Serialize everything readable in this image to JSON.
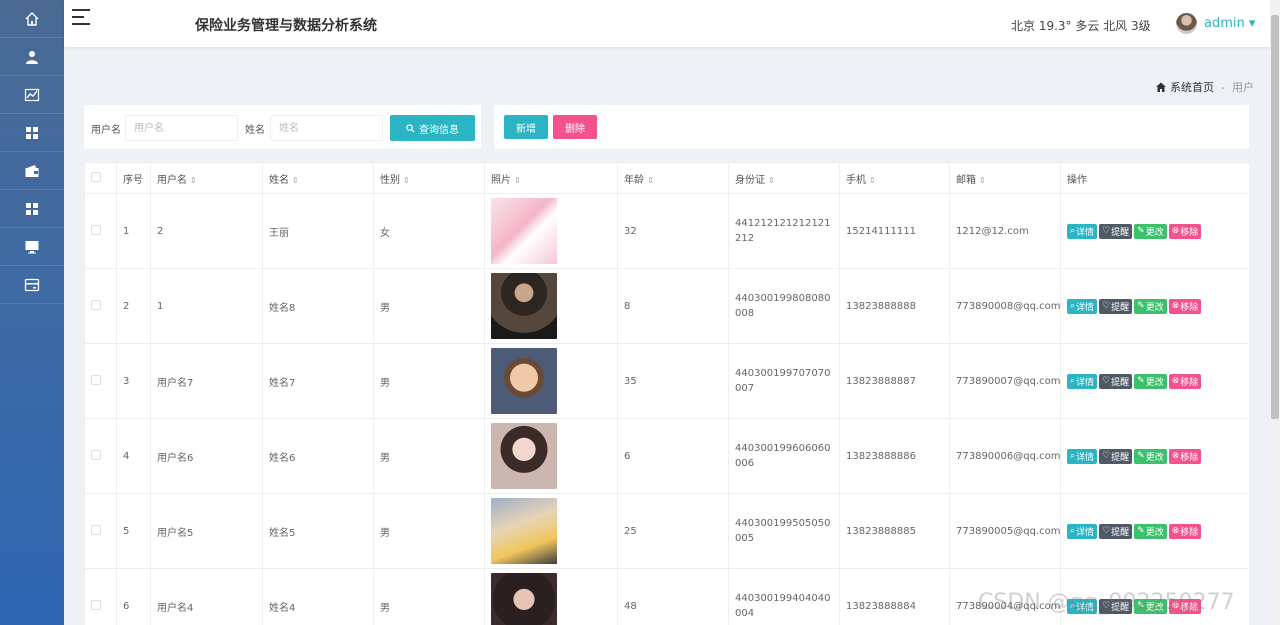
{
  "header": {
    "app_title": "保险业务管理与数据分析系统",
    "weather": "北京  19.3°  多云  北风  3级",
    "user": "admin ▾"
  },
  "sidebar": {
    "items": [
      {
        "icon": "home-icon"
      },
      {
        "icon": "user-icon"
      },
      {
        "icon": "chart-icon"
      },
      {
        "icon": "grid-icon"
      },
      {
        "icon": "wallet-icon"
      },
      {
        "icon": "grid-icon"
      },
      {
        "icon": "monitor-icon"
      },
      {
        "icon": "card-icon"
      }
    ]
  },
  "breadcrumb": {
    "home": "系统首页",
    "separator": "-",
    "current": "用户"
  },
  "search": {
    "username_label": "用户名",
    "username_placeholder": "用户名",
    "name_label": "姓名",
    "name_placeholder": "姓名",
    "query_button": "查询信息"
  },
  "actions": {
    "add": "新增",
    "delete": "删除"
  },
  "table": {
    "headers": [
      "序号",
      "用户名",
      "姓名",
      "性别",
      "照片",
      "年龄",
      "身份证",
      "手机",
      "邮箱",
      "操作"
    ],
    "op_labels": {
      "detail": "详情",
      "remind": "提醒",
      "edit": "更改",
      "remove": "移除"
    },
    "rows": [
      {
        "no": "1",
        "username": "2",
        "name": "王丽",
        "gender": "女",
        "photo": "pink-anime",
        "age": "32",
        "idcard": "441212121212121212",
        "phone": "15214111111",
        "email": "1212@12.com"
      },
      {
        "no": "2",
        "username": "1",
        "name": "姓名8",
        "gender": "男",
        "photo": "dark-portrait",
        "age": "8",
        "idcard": "440300199808080008",
        "phone": "13823888888",
        "email": "773890008@qq.com"
      },
      {
        "no": "3",
        "username": "用户名7",
        "name": "姓名7",
        "gender": "男",
        "photo": "cartoon-boy",
        "age": "35",
        "idcard": "440300199707070007",
        "phone": "13823888887",
        "email": "773890007@qq.com"
      },
      {
        "no": "4",
        "username": "用户名6",
        "name": "姓名6",
        "gender": "男",
        "photo": "girl-portrait",
        "age": "6",
        "idcard": "440300199606060006",
        "phone": "13823888886",
        "email": "773890006@qq.com"
      },
      {
        "no": "5",
        "username": "用户名5",
        "name": "姓名5",
        "gender": "男",
        "photo": "girl-yellow",
        "age": "25",
        "idcard": "440300199505050005",
        "phone": "13823888885",
        "email": "773890005@qq.com"
      },
      {
        "no": "6",
        "username": "用户名4",
        "name": "姓名4",
        "gender": "男",
        "photo": "dark-girl",
        "age": "48",
        "idcard": "440300199404040004",
        "phone": "13823888884",
        "email": "773890004@qq.com"
      }
    ]
  },
  "watermark": "CSDN @qq_992250277",
  "colors": {
    "accent": "#2bb4c4",
    "danger": "#f4518f",
    "success": "#3cc06b",
    "dark": "#4f5a66"
  }
}
